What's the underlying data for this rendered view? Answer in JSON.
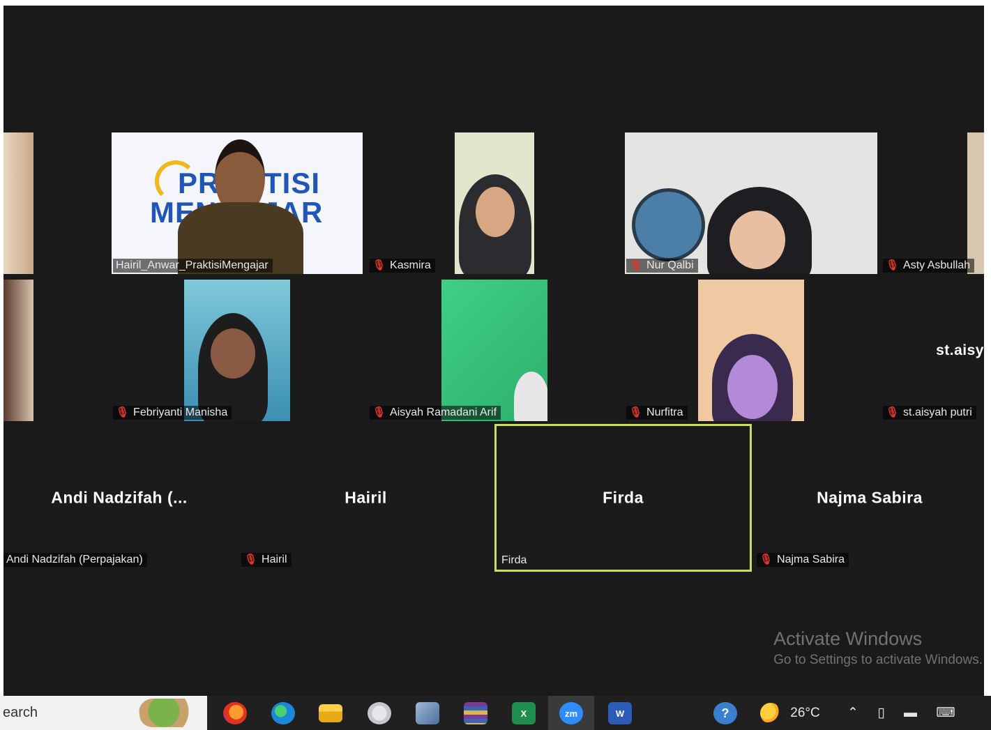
{
  "gallery": {
    "row1": [
      {
        "label": "Hairil_Anwar_PraktisiMengajar"
      },
      {
        "label": "Kasmira"
      },
      {
        "label": "Nur Qalbi"
      },
      {
        "label": "Asty Asbullah"
      }
    ],
    "row2": [
      {
        "label": "Febriyanti Manisha"
      },
      {
        "label": "Aisyah Ramadani Arif"
      },
      {
        "label": "Nurfitra"
      },
      {
        "label": "st.aisyah putri",
        "big_name": "st.aisy"
      }
    ],
    "row3": [
      {
        "big_name": "Andi Nadzifah (...",
        "label": "Andi Nadzifah (Perpajakan)"
      },
      {
        "big_name": "Hairil",
        "label": "Hairil"
      },
      {
        "big_name": "Firda",
        "label": "Firda"
      },
      {
        "big_name": "Najma Sabira",
        "label": "Najma Sabira"
      }
    ],
    "logo_line1": "PRAKTISI",
    "logo_line2": "MENGAJAR"
  },
  "watermark": {
    "line1": "Activate Windows",
    "line2": "Go to Settings to activate Windows."
  },
  "taskbar": {
    "search_text": "earch",
    "apps": [
      "firefox-icon",
      "edge-icon",
      "file-explorer-icon",
      "paint-icon",
      "control-panel-icon",
      "winrar-icon",
      "excel-icon",
      "zoom-icon",
      "word-icon"
    ],
    "zoom_label": "zm",
    "excel_label": "X",
    "word_label": "W",
    "weather_temp": "26°C"
  },
  "colors": {
    "active_speaker": "#c7df5a",
    "muted_mic": "#e0342b"
  }
}
